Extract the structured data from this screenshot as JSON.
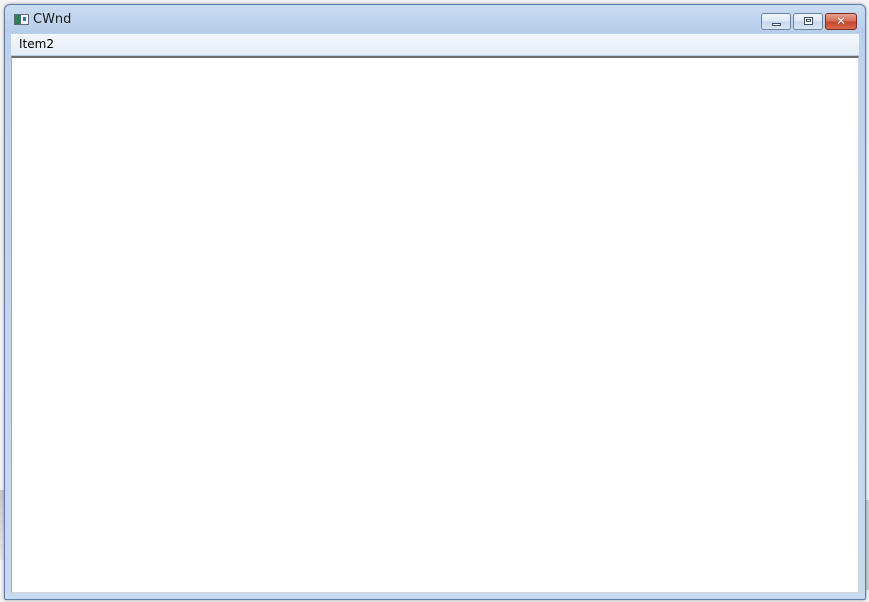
{
  "window": {
    "title": "CWnd",
    "icon": "app-window-icon",
    "controls": {
      "minimize": "minimize-icon",
      "maximize": "maximize-icon",
      "close": "close-icon",
      "close_glyph": "✕"
    }
  },
  "menubar": {
    "items": [
      {
        "label": "Item2"
      }
    ]
  },
  "colors": {
    "titlebar": "#c9dcf3",
    "close_button": "#c2432a",
    "client_background": "#ffffff"
  }
}
